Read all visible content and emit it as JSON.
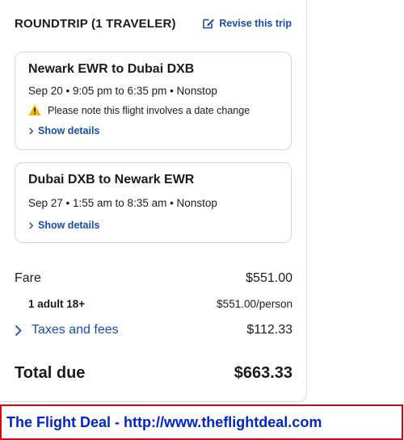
{
  "header": {
    "title": "ROUNDTRIP (1 TRAVELER)",
    "revise_label": "Revise this trip"
  },
  "flights": [
    {
      "route": "Newark EWR to Dubai DXB",
      "times": "Sep 20 • 9:05 pm to 6:35 pm • Nonstop",
      "notice": "Please note this flight involves a date change",
      "details_label": "Show details"
    },
    {
      "route": "Dubai DXB to Newark EWR",
      "times": "Sep 27 • 1:55 am to 8:35 am • Nonstop",
      "details_label": "Show details"
    }
  ],
  "pricing": {
    "fare_label": "Fare",
    "fare_value": "$551.00",
    "traveler_label": "1 adult 18+",
    "traveler_value": "$551.00/person",
    "taxes_label": "Taxes and fees",
    "taxes_value": "$112.33",
    "total_label": "Total due",
    "total_value": "$663.33"
  },
  "watermark": {
    "text": "The Flight Deal - http://www.theflightdeal.com"
  },
  "colors": {
    "link": "#1a4ab1",
    "warning": "#f2b705",
    "banner_border": "#e0000f",
    "banner_text": "#0026c8"
  }
}
